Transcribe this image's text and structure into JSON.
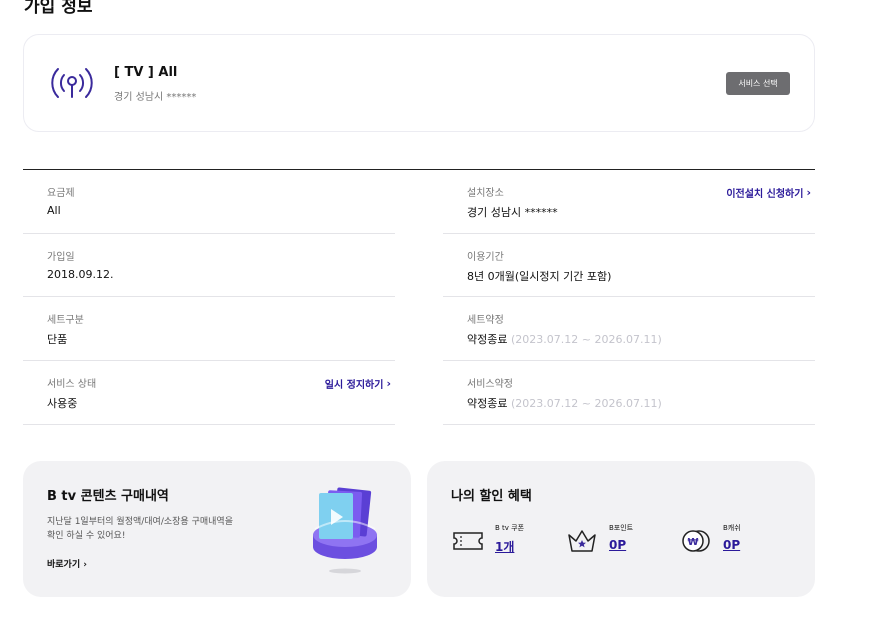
{
  "page": {
    "title": "가입 정보"
  },
  "service": {
    "name": "[ TV ] All",
    "address": "경기 성남시 ******",
    "select_label": "서비스 선택"
  },
  "info": {
    "left": [
      {
        "label": "요금제",
        "value": "All"
      },
      {
        "label": "가입일",
        "value": "2018.09.12."
      },
      {
        "label": "세트구분",
        "value": "단품"
      },
      {
        "label": "서비스 상태",
        "value": "사용중",
        "link": "일시 정지하기"
      }
    ],
    "right": [
      {
        "label": "설치장소",
        "value": "경기 성남시 ******",
        "link": "이전설치 신청하기"
      },
      {
        "label": "이용기간",
        "value": "8년 0개월(일시정지 기간 포함)"
      },
      {
        "label": "세트약정",
        "value": "약정종료",
        "period": "(2023.07.12 ~ 2026.07.11)"
      },
      {
        "label": "서비스약정",
        "value": "약정종료",
        "period": "(2023.07.12 ~ 2026.07.11)"
      }
    ]
  },
  "purchase": {
    "title": "B tv 콘텐츠 구매내역",
    "desc_line1": "지난달 1일부터의 월정액/대여/소장용 구매내역을",
    "desc_line2": "확인 하실 수 있어요!",
    "link": "바로가기"
  },
  "benefits": {
    "title": "나의 할인 혜택",
    "items": [
      {
        "label": "B tv 쿠폰",
        "value": "1개",
        "icon": "coupon-icon"
      },
      {
        "label": "B포인트",
        "value": "0P",
        "icon": "crown-icon"
      },
      {
        "label": "B캐쉬",
        "value": "0P",
        "icon": "cash-coin-icon"
      }
    ]
  },
  "colors": {
    "accent": "#2b1a9a",
    "button_gray": "#6d6d70",
    "card_bg": "#f2f2f4"
  }
}
